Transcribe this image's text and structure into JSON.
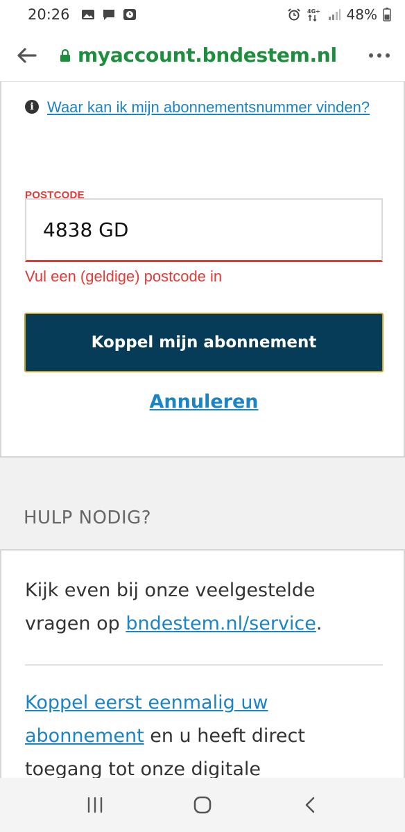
{
  "status": {
    "time": "20:26",
    "battery_pct": "48%",
    "network": "4G+",
    "icons_left": [
      "gallery-icon",
      "message-icon",
      "clock-app-icon"
    ],
    "icons_right": [
      "alarm-icon",
      "network-arrows-icon",
      "signal-icon",
      "battery-icon"
    ]
  },
  "browser": {
    "url": "myaccount.bndestem.nl",
    "back_icon": "back-arrow-icon",
    "lock_icon": "lock-icon",
    "menu_icon": "more-vert-icon"
  },
  "form": {
    "help_link": "Waar kan ik mijn abonnementsnummer vinden?",
    "postcode_label": "POSTCODE",
    "postcode_value": "4838 GD",
    "postcode_error": "Vul een (geldige) postcode in",
    "submit_label": "Koppel mijn abonnement",
    "cancel_label": "Annuleren"
  },
  "help": {
    "heading": "HULP NODIG?",
    "p1_prefix": "Kijk even bij onze veelgestelde vragen op ",
    "p1_link": "bndestem.nl/service",
    "p1_suffix": ".",
    "p2_link": "Koppel eerst eenmalig uw abonnement",
    "p2_suffix": " en u heeft direct toegang tot onze digitale"
  },
  "colors": {
    "url_green": "#1e8e3e",
    "error_red": "#e53935",
    "button_navy": "#063c57",
    "button_border_gold": "#c9a227",
    "link_blue": "#1a84c6"
  },
  "nav": {
    "recent_icon": "recent-apps-icon",
    "home_icon": "home-icon",
    "back_icon": "nav-back-icon"
  }
}
